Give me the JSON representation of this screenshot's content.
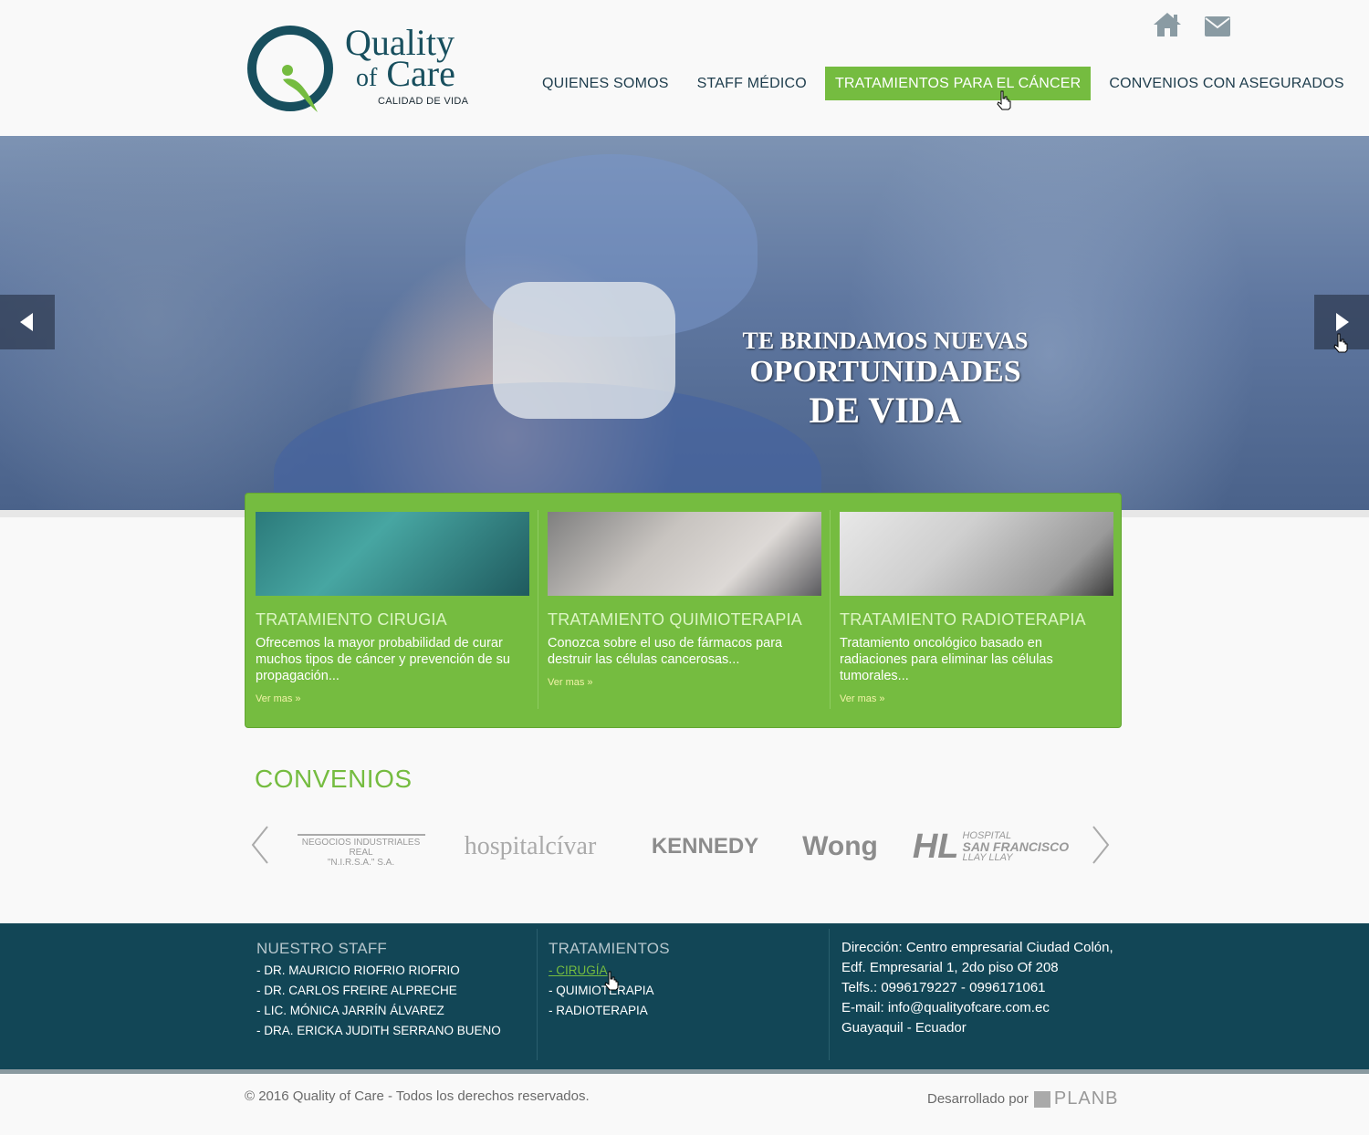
{
  "header": {
    "logo": {
      "line1": "Quality",
      "line2_small": "of",
      "line2": "Care",
      "tagline": "CALIDAD DE VIDA"
    },
    "icons": [
      "home-icon",
      "mail-icon"
    ],
    "nav": [
      {
        "label": "QUIENES SOMOS",
        "active": false
      },
      {
        "label": "STAFF MÉDICO",
        "active": false
      },
      {
        "label": "TRATAMIENTOS PARA EL CÁNCER",
        "active": true
      },
      {
        "label": "CONVENIOS CON ASEGURADOS",
        "active": false
      }
    ]
  },
  "hero": {
    "line1": "TE BRINDAMOS NUEVAS",
    "line2": "OPORTUNIDADES",
    "line3": "DE VIDA"
  },
  "treatments": [
    {
      "title": "TRATAMIENTO CIRUGIA",
      "desc": "Ofrecemos la mayor probabilidad de curar muchos tipos de cáncer y prevención de su propagación...",
      "more": "Ver mas »"
    },
    {
      "title": "TRATAMIENTO QUIMIOTERAPIA",
      "desc": "Conozca sobre el uso de fármacos para destruir las células cancerosas...",
      "more": "Ver mas »"
    },
    {
      "title": "TRATAMIENTO RADIOTERAPIA",
      "desc": "Tratamiento oncológico basado en radiaciones para eliminar las células tumorales...",
      "more": "Ver mas »"
    }
  ],
  "convenios": {
    "title": "CONVENIOS",
    "logos": {
      "nirsa_line1": "NEGOCIOS INDUSTRIALES REAL",
      "nirsa_line2": "\"N.I.R.S.A.\" S.A.",
      "alcivar": "hospitalcívar",
      "kennedy": "KENNEDY",
      "wong": "Wong",
      "hl": "HL",
      "sf_line1": "HOSPITAL",
      "sf_line2": "SAN FRANCISCO",
      "sf_line3": "LLAY LLAY"
    }
  },
  "footer": {
    "staff_title": "NUESTRO STAFF",
    "staff": [
      "- DR. MAURICIO RIOFRIO RIOFRIO",
      "- DR. CARLOS FREIRE ALPRECHE",
      "- LIC. MÓNICA JARRÍN ÁLVAREZ",
      "- DRA. ERICKA JUDITH SERRANO BUENO"
    ],
    "treat_title": "TRATAMIENTOS",
    "treats": [
      {
        "label": "- CIRUGÍA",
        "highlight": true
      },
      {
        "label": "- QUIMIOTERAPIA",
        "highlight": false
      },
      {
        "label": "- RADIOTERAPIA",
        "highlight": false
      }
    ],
    "address": [
      "Dirección: Centro empresarial Ciudad Colón,",
      "Edf. Empresarial 1, 2do piso Of 208",
      "Telfs.: 0996179227 - 0996171061",
      "E-mail: info@qualityofcare.com.ec",
      "Guayaquil - Ecuador"
    ],
    "copyright": "© 2016 Quality of Care  -  Todos los derechos reservados.",
    "dev_label": "Desarrollado por",
    "dev_brand": "PLANB"
  },
  "colors": {
    "brand_green": "#75bc40",
    "brand_teal": "#124656",
    "logo_navy": "#184f5e"
  }
}
